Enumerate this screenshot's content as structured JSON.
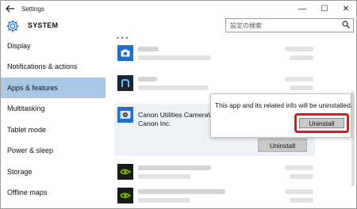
{
  "window": {
    "title": "Settings",
    "back_icon": "back-arrow-icon",
    "minimize_glyph": "—",
    "maximize_glyph": "☐",
    "close_glyph": "✕"
  },
  "header": {
    "section": "SYSTEM",
    "section_icon": "gear-icon",
    "search_placeholder": "設定の検索",
    "search_icon": "search-icon"
  },
  "sidebar": {
    "items": [
      {
        "label": "Display"
      },
      {
        "label": "Notifications & actions"
      },
      {
        "label": "Apps & features"
      },
      {
        "label": "Multitasking"
      },
      {
        "label": "Tablet mode"
      },
      {
        "label": "Power & sleep"
      },
      {
        "label": "Storage"
      },
      {
        "label": "Offline maps"
      }
    ],
    "selected_index": 2
  },
  "content": {
    "scroll_indicator": "• • •",
    "selected_app": {
      "name": "Canon Utilities CameraW",
      "publisher": "Canon Inc.",
      "uninstall_label": "Uninstall"
    },
    "flyout": {
      "message": "This app and its related info will be uninstalled.",
      "uninstall_label": "Uninstall"
    }
  },
  "colors": {
    "selected_nav": "#a9c8e8",
    "accent_blue": "#1e6fd0",
    "highlight_red": "#e8141c",
    "nvidia_green": "#76b900"
  }
}
